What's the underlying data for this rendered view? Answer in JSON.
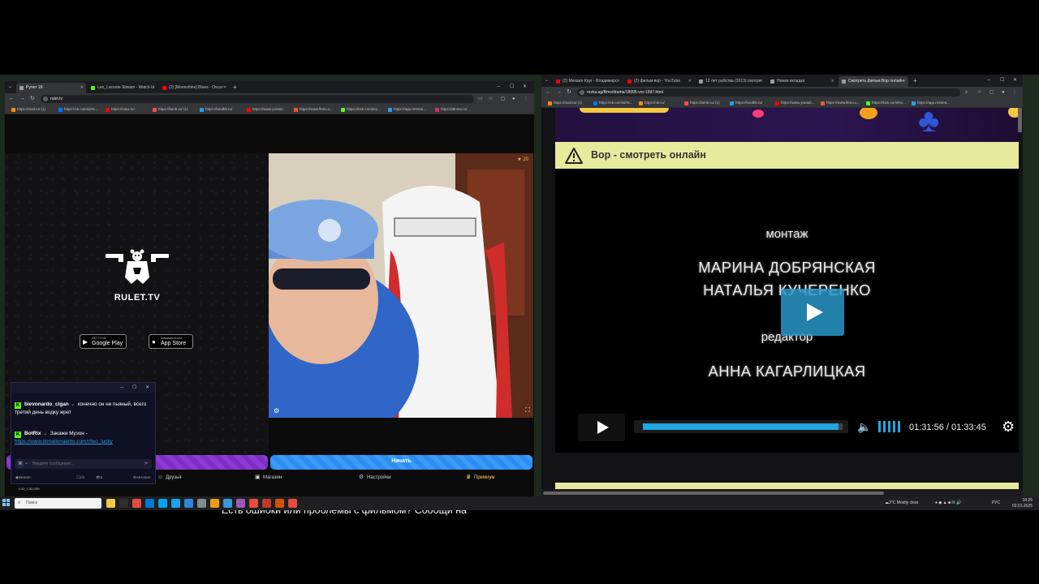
{
  "left_window": {
    "tabs": [
      {
        "title": "Рулет 18",
        "active": true,
        "favicon_color": "#9e9e9e"
      },
      {
        "title": "Leo_Lacoste Stream - Watch Li",
        "active": false,
        "favicon_color": "#53fc18"
      },
      {
        "title": "(2) [Moonshine] Blues - Oscar",
        "active": false,
        "favicon_color": "#ff0000"
      }
    ],
    "url": "rulet.tv",
    "bookmarks": [
      {
        "label": "https://mail.ru/ (1)",
        "color": "#ff8a00"
      },
      {
        "label": "https://vk.com/al78...",
        "color": "#0077ff"
      },
      {
        "label": "https://roku.ru/",
        "color": "#ff0000"
      },
      {
        "label": "https://lamb.ru/ (1)",
        "color": "#ff4a4a"
      },
      {
        "label": "https://londbk.ru/",
        "color": "#1da1f2"
      },
      {
        "label": "https://www.youtub...",
        "color": "#ff0000"
      },
      {
        "label": "https://www.lkmu.u...",
        "color": "#e25c25"
      },
      {
        "label": "https://kick.com/leo...",
        "color": "#53fc18"
      },
      {
        "label": "https://app.restrea...",
        "color": "#1da1f2"
      },
      {
        "label": "https://dtnmo.ru/...",
        "color": "#cc3366"
      }
    ],
    "logo_name": "RULET.TV",
    "store_buttons": [
      {
        "small": "GET IT ON",
        "large": "Google Play",
        "icon": "google-play-icon"
      },
      {
        "small": "Download on the",
        "large": "App Store",
        "icon": "apple-icon"
      }
    ],
    "cam_viewers": "20",
    "start_button": "Начать",
    "nav": [
      {
        "label": "Друзья",
        "icon": "friends-icon"
      },
      {
        "label": "Магазин",
        "icon": "shop-icon"
      },
      {
        "label": "Настройки",
        "icon": "gear-icon"
      },
      {
        "label": "Премиум",
        "icon": "premium-icon"
      }
    ]
  },
  "chat": {
    "messages": [
      {
        "user": "biеvonardo_cigan",
        "text": "конечно он не пьяный, всего третий день водку жрет"
      },
      {
        "user": "BotRix",
        "text": "Закажи Музон -",
        "link": "https://www.donationalerts.com/r/leo_lucky"
      }
    ],
    "input_placeholder": "Введите сообщение...",
    "footer": {
      "stream": "Stream: Leo_Lacoste",
      "counter": "1/1",
      "viewers": "5",
      "setting": "Автопол"
    }
  },
  "right_window": {
    "tabs": [
      {
        "title": "(2) Михаил Круг - Владимирс",
        "favicon_color": "#ff0000",
        "active": false
      },
      {
        "title": "(2) фильм вор - YouTube",
        "favicon_color": "#ff0000",
        "active": false
      },
      {
        "title": "12 лет рабства (2013) смотре",
        "favicon_color": "#9aa0a6",
        "active": false
      },
      {
        "title": "Новая вкладка",
        "favicon_color": "#9aa0a6",
        "active": false
      },
      {
        "title": "Смотреть фильм Вор онлайн",
        "favicon_color": "#9aa0a6",
        "active": true
      }
    ],
    "url": "rezka.ag/films/drama/18095-vor-1997.html",
    "bookmarks": [
      {
        "label": "https://mail.ru/ (1)",
        "color": "#ff8a00"
      },
      {
        "label": "https://vk.com/al78...",
        "color": "#0077ff"
      },
      {
        "label": "https://ok.ru/",
        "color": "#ff8a00"
      },
      {
        "label": "https://lamb.ru/ (1)",
        "color": "#ff4a4a"
      },
      {
        "label": "https://londbk.ru/",
        "color": "#1da1f2"
      },
      {
        "label": "https://www.youtub...",
        "color": "#ff0000"
      },
      {
        "label": "https://www.lkmu.u...",
        "color": "#e25c25"
      },
      {
        "label": "https://kick.com/leo...",
        "color": "#53fc18"
      },
      {
        "label": "https://app.restrea...",
        "color": "#1da1f2"
      }
    ],
    "title_bar": "Вор - смотреть онлайн",
    "credits": [
      "монтаж",
      "МАРИНА ДОБРЯНСКАЯ",
      "НАТАЛЬЯ КУЧЕРЕНКО",
      "редактор",
      "АННА КАГАРЛИЦКАЯ"
    ],
    "player": {
      "current": "01:31:56",
      "separator": "/",
      "duration": "01:33:45",
      "progress": 0.981
    },
    "report_text": "Есть ошибки или проблемы с фильмом? Сообщи на"
  },
  "taskbar": {
    "search_placeholder": "Поиск",
    "apps": [
      "#f6c945",
      "#2e2e2e",
      "#e74c3c",
      "#0078d4",
      "#00a4ef",
      "#1da1f2",
      "#2e86de",
      "#7f8c8d",
      "#f39c12",
      "#3498db",
      "#9b59b6",
      "#e74c3c",
      "#c0392b",
      "#d35400",
      "#e74c3c"
    ],
    "weather": "3°C  Mostly clear",
    "lang": "РУС",
    "time": "18:25",
    "date": "02.01.2025"
  }
}
